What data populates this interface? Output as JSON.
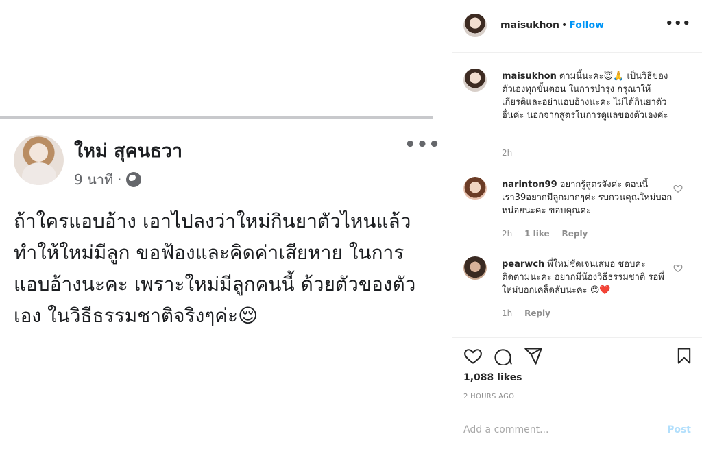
{
  "facebook_post": {
    "name": "ใหม่ สุคนธวา",
    "time": "9 นาที",
    "separator": "·",
    "more": "•••",
    "text": "ถ้าใครแอบอ้าง เอาไปลงว่าใหม่กินยาตัวไหนแล้ว ทำให้ใหม่มีลูก ขอฟ้องและคิดค่าเสียหาย ในการแอบอ้างนะคะ เพราะใหม่มีลูกคนนี้ ด้วยตัวของตัว เอง ในวิธีธรรมชาติจริงๆค่ะ😌"
  },
  "header": {
    "username": "maisukhon",
    "dot": "•",
    "follow_label": "Follow",
    "more": "•••"
  },
  "comments": [
    {
      "username": "maisukhon",
      "text": "ตามนี้นะคะ😇🙏 เป็นวิธีของตัวเองทุกขั้นตอน ในการบำรุง กรุณาให้เกียรติและอย่าแอบอ้างนะคะ ไม่ได้กินยาตัวอื่นค่ะ นอกจากสูตรในการดูแลของตัวเองค่ะ",
      "time": "2h"
    },
    {
      "username": "narinton99",
      "text": "อยากรู้สูตรจังค่ะ ตอนนี้เรา39อยากมีลูกมากๆค่ะ รบกวนคุณใหม่บอกหน่อยนะคะ ขอบคุณค่ะ",
      "time": "2h",
      "likes": "1 like",
      "reply": "Reply"
    },
    {
      "username": "pearwch",
      "text": "พี่ใหม่ชัดเจนเสมอ ชอบค่ะ ติดตามนะคะ อยากมีน้องวิธีธรรมชาติ รอพี่ใหม่บอกเคล็ดลับนะคะ 😍❤️",
      "time": "1h",
      "reply": "Reply"
    }
  ],
  "actions": {
    "icons": [
      "heart-icon",
      "comment-icon",
      "share-icon",
      "bookmark-icon"
    ],
    "likes": "1,088 likes",
    "time_ago": "2 HOURS AGO"
  },
  "add_comment": {
    "placeholder": "Add a comment...",
    "post_label": "Post"
  }
}
